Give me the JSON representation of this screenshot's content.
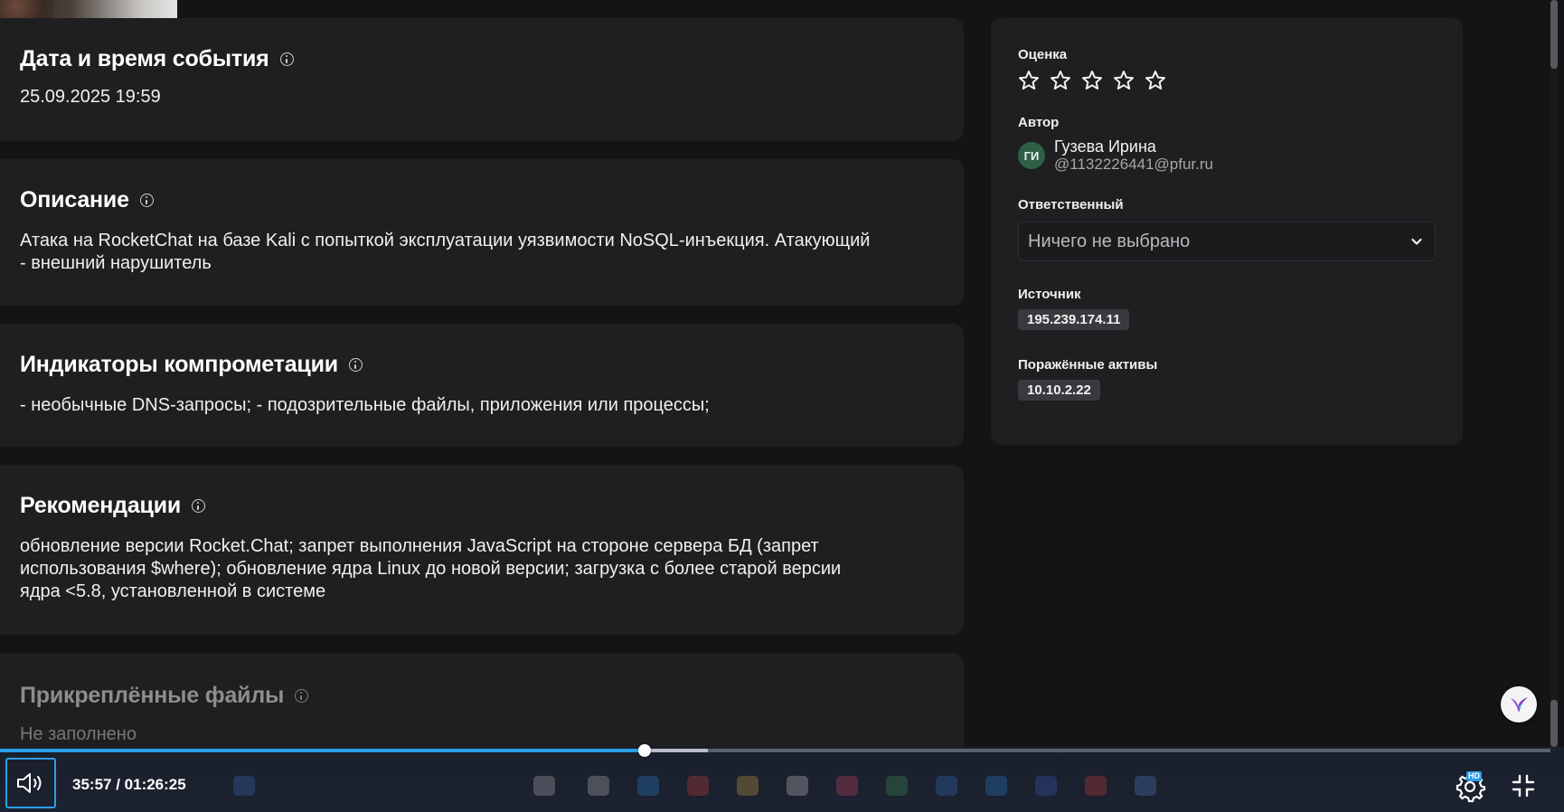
{
  "sections": {
    "datetime": {
      "title": "Дата и время события",
      "value": "25.09.2025 19:59"
    },
    "description": {
      "title": "Описание",
      "line1": "Атака на RocketChat на базе Kali с попыткой эксплуатации уязвимости NoSQL-инъекция. Атакующий",
      "line2": "- внешний нарушитель"
    },
    "ioc": {
      "title": "Индикаторы компрометации",
      "value": "- необычные DNS-запросы; - подозрительные файлы, приложения или процессы;"
    },
    "recommendations": {
      "title": "Рекомендации",
      "line1": "обновление версии Rocket.Chat; запрет выполнения JavaScript на стороне сервера БД (запрет",
      "line2": "использования $where); обновление ядра Linux до новой версии; загрузка с более старой версии",
      "line3": "ядра <5.8, установленной в системе"
    },
    "attachments": {
      "title": "Прикреплённые файлы",
      "value": "Не заполнено"
    }
  },
  "sidebar": {
    "rating_label": "Оценка",
    "rating_value": 0,
    "rating_max": 5,
    "author_label": "Автор",
    "author_initials": "ГИ",
    "author_name": "Гузева Ирина",
    "author_login": "@1132226441@pfur.ru",
    "assignee_label": "Ответственный",
    "assignee_value": "Ничего не выбрано",
    "source_label": "Источник",
    "source_value": "195.239.174.11",
    "assets_label": "Поражённые активы",
    "assets_value": "10.10.2.22"
  },
  "player": {
    "time_current": "35:57",
    "time_separator": " / ",
    "time_total": "01:26:25",
    "progress_fraction": 0.4158,
    "buffer_fraction": 0.4564,
    "quality_badge": "HD"
  },
  "colors": {
    "accent": "#2b9de8",
    "card_bg": "#1f1f22",
    "page_bg": "#141416",
    "avatar_bg": "#2f5f45"
  }
}
